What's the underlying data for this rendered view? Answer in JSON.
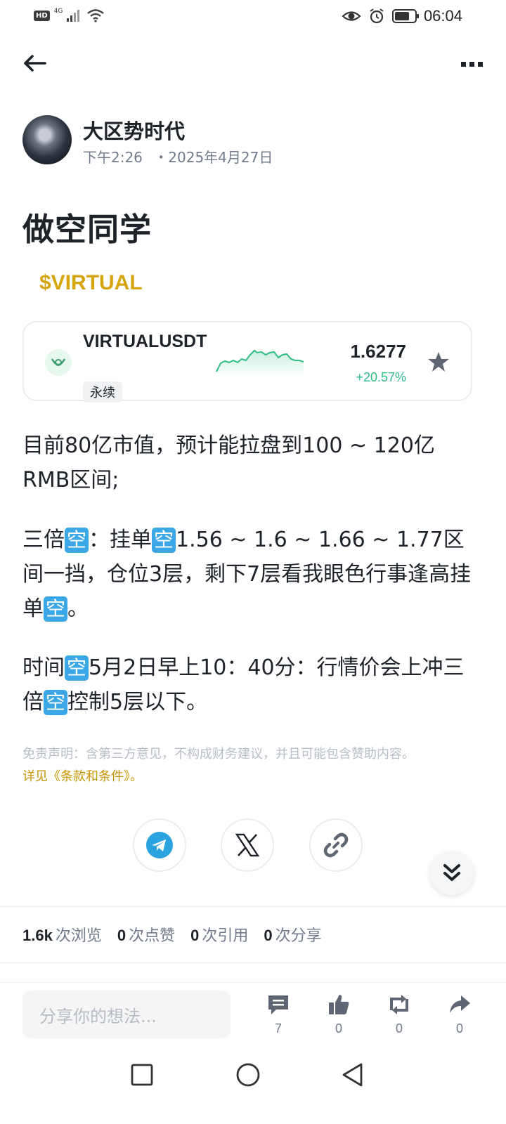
{
  "status_bar": {
    "hd": "HD",
    "network": "4G",
    "time": "06:04"
  },
  "author": {
    "name": "大区势时代",
    "time": "下午2:26",
    "date": "・2025年4月27日"
  },
  "post": {
    "title": "做空同学",
    "cashtag": "$VIRTUAL",
    "emoji": "空",
    "paragraphs": {
      "p1": "  目前80亿市值，预计能拉盘到100 ~ 120亿RMB区间;",
      "p2a": "三倍",
      "p2b": "：挂单",
      "p2c": "1.56 ~ 1.6 ~ 1.66 ~ 1.77区间一挡，仓位3层，剩下7层看我眼色行事逢高挂单",
      "p2d": "。",
      "p3a": "时间",
      "p3b": "5月2日早上10：40分：行情价会上冲三倍",
      "p3c": "控制5层以下。"
    },
    "disclaimer": "免责声明：含第三方意见，不构成财务建议，并且可能包含赞助内容。",
    "terms": " 详见《条款和条件》。"
  },
  "ticker": {
    "symbol": "VIRTUALUSDT",
    "tag": "永续",
    "price": "1.6277",
    "change": "+20.57%",
    "up_color": "#2ebd85"
  },
  "share": {
    "buttons": [
      "telegram-icon",
      "x-icon",
      "link-icon"
    ]
  },
  "stats": {
    "views_num": "1.6k",
    "views_label": "次浏览",
    "likes_num": "0",
    "likes_label": "次点赞",
    "quotes_num": "0",
    "quotes_label": "次引用",
    "shares_num": "0",
    "shares_label": "次分享"
  },
  "bottom_bar": {
    "placeholder": "分享你的想法...",
    "comments": "7",
    "likes": "0",
    "reposts": "0",
    "shares": "0"
  },
  "colors": {
    "accent": "#d4a50e",
    "telegram": "#2aa3e0",
    "text": "#1e2329",
    "muted": "#707a8a"
  }
}
